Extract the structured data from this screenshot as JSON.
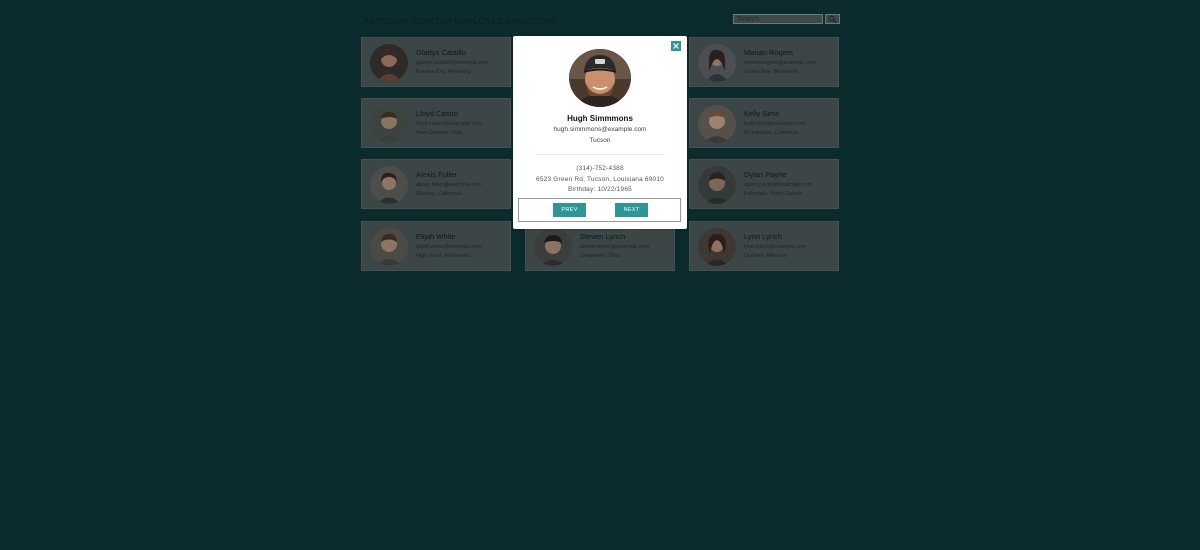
{
  "header": {
    "title": "AWESOME STARTUP EMPLOYEE DIRECTORY",
    "search_placeholder": "Search",
    "search_icon": "magnifier-icon"
  },
  "employees": [
    {
      "name": "Gladys Castillo",
      "email": "gladys.castillo@example.com",
      "location": "Kansas City, Wyoming"
    },
    {
      "name": "Marian Rogers",
      "email": "marian.rogers@example.com",
      "location": "Green Bay, Wisconsin"
    },
    {
      "name": "Lloyd Castro",
      "email": "lloyd.castro@example.com",
      "location": "New Orleans, Utah"
    },
    {
      "name": "Kelly Sims",
      "email": "kelly.sims@example.com",
      "location": "Richardson, California"
    },
    {
      "name": "Alexis Fuller",
      "email": "alexis.fuller@example.com",
      "location": "Greeley, California"
    },
    {
      "name": "Dylan Payne",
      "email": "dylan.payne@example.com",
      "location": "Palmdale, North Dakota"
    },
    {
      "name": "Elijah White",
      "email": "elijah.white@example.com",
      "location": "High Point, Minnesota"
    },
    {
      "name": "Steven Lynch",
      "email": "steven.lynch@example.com",
      "location": "Seagoville, Ohio"
    },
    {
      "name": "Lynn Lynch",
      "email": "lynn.lynch@example.com",
      "location": "Durham, Missouri"
    }
  ],
  "modal": {
    "name": "Hugh Simmmons",
    "email": "hugh.simmmons@example.com",
    "city": "Tucson",
    "phone": "(314)-752-4388",
    "address": "6523 Green Rd, Tucson, Louisiana 69010",
    "birthday": "Birthday: 10/22/1965",
    "prev_label": "PREV",
    "next_label": "NEXT",
    "close_icon": "close-icon"
  },
  "colors": {
    "background": "#0c2b2c",
    "card": "#3d4646",
    "accent": "#2e9695"
  }
}
